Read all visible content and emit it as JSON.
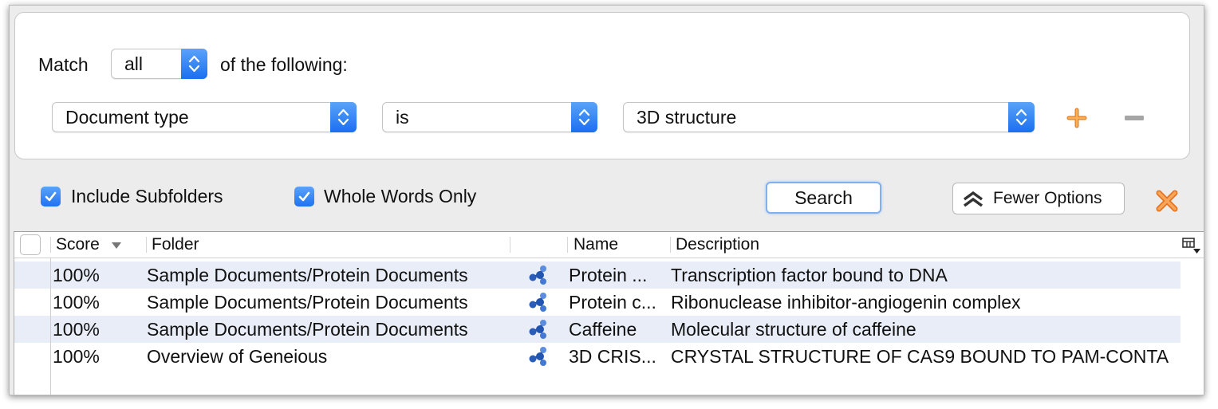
{
  "criteria": {
    "match_label": "Match",
    "match_value": "all",
    "following_label": "of the following:",
    "field_value": "Document type",
    "operator_value": "is",
    "value_value": "3D structure"
  },
  "options": {
    "include_subfolders": "Include Subfolders",
    "whole_words_only": "Whole Words Only",
    "search_button": "Search",
    "fewer_options_button": "Fewer Options"
  },
  "colors": {
    "accent_blue": "#1f72f2",
    "add_orange": "#f39a3c",
    "row_alt": "#e8edf7"
  },
  "table": {
    "headers": {
      "score": "Score",
      "folder": "Folder",
      "name": "Name",
      "description": "Description"
    },
    "rows": [
      {
        "score": "100%",
        "folder": "Sample Documents/Protein Documents",
        "icon": "molecule-icon",
        "name": "Protein ...",
        "description": "Transcription factor bound to DNA"
      },
      {
        "score": "100%",
        "folder": "Sample Documents/Protein Documents",
        "icon": "molecule-icon",
        "name": "Protein c...",
        "description": "Ribonuclease inhibitor-angiogenin complex"
      },
      {
        "score": "100%",
        "folder": "Sample Documents/Protein Documents",
        "icon": "molecule-icon",
        "name": "Caffeine",
        "description": "Molecular structure of caffeine"
      },
      {
        "score": "100%",
        "folder": "Overview of Geneious",
        "icon": "molecule-icon",
        "name": "3D CRIS...",
        "description": "CRYSTAL STRUCTURE OF CAS9 BOUND TO PAM-CONTA"
      }
    ]
  }
}
